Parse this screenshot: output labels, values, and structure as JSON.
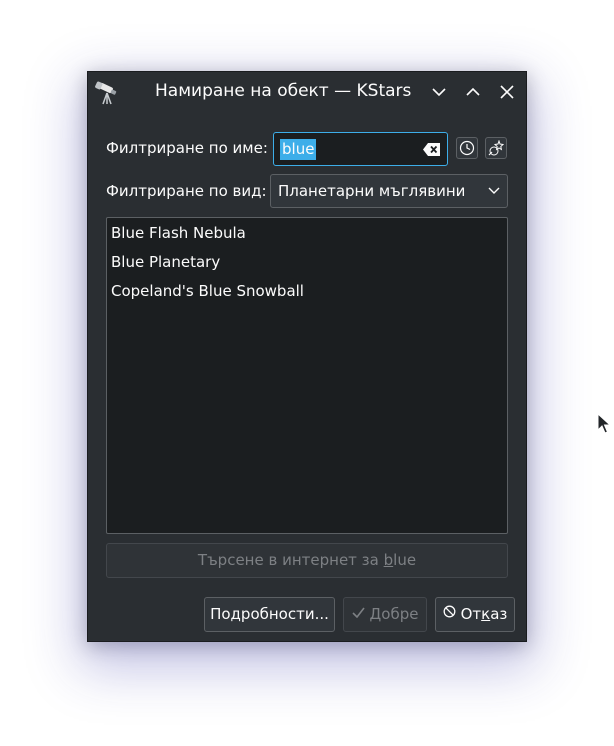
{
  "window": {
    "title": "Намиране на обект — KStars"
  },
  "filters": {
    "name_label": "Филтриране по име:",
    "name_value": "blue",
    "type_label": "Филтриране по вид:",
    "type_value": "Планетарни мъглявини"
  },
  "results": {
    "items": [
      "Blue Flash Nebula",
      "Blue Planetary",
      "Copeland's Blue Snowball"
    ]
  },
  "internet_search": {
    "label_prefix": "Търсене в интернет за ",
    "label_accel": "b",
    "label_rest": "lue"
  },
  "buttons": {
    "details_label": "Подробности...",
    "ok_prefix": "",
    "ok_accel": "Д",
    "ok_rest": "обре",
    "cancel_prefix": "От",
    "cancel_accel": "к",
    "cancel_rest": "аз"
  },
  "icons": {
    "app": "telescope-icon",
    "minimize": "chevron-down-icon",
    "maximize": "chevron-up-icon",
    "close": "close-icon",
    "clear": "clear-text-icon",
    "history": "clock-icon",
    "options": "star-wand-icon",
    "ok": "check-icon",
    "cancel": "cancel-icon"
  },
  "colors": {
    "accent": "#3daee9",
    "window_bg": "#2a2e32",
    "view_bg": "#1b1e20",
    "text": "#fcfcfc",
    "disabled_text": "#7d8084"
  }
}
